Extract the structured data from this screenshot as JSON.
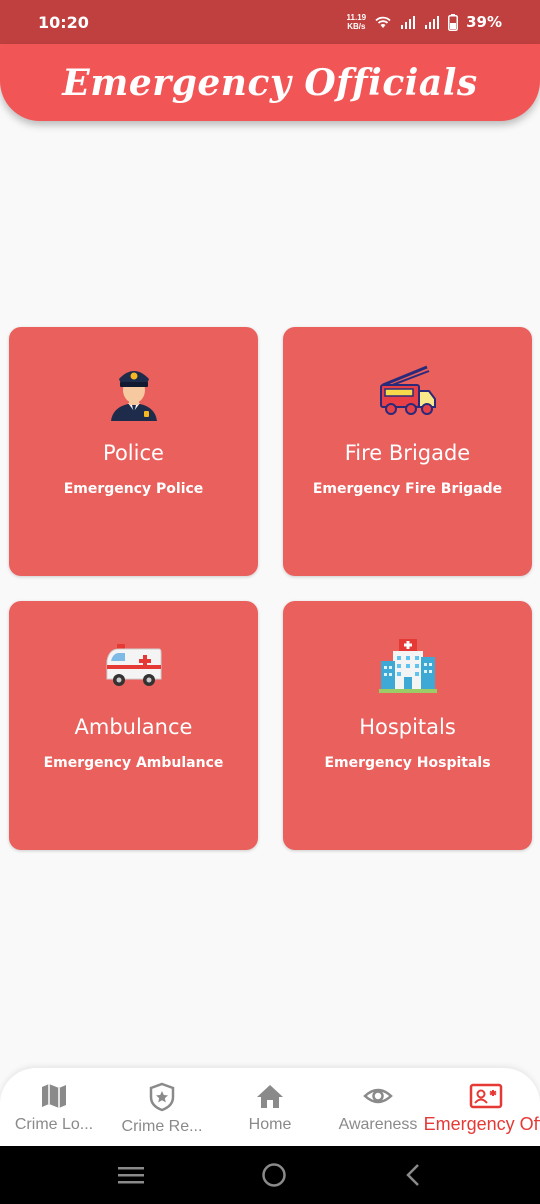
{
  "status_bar": {
    "time": "10:20",
    "net_speed_value": "11.19",
    "net_speed_unit": "KB/s",
    "battery_percent": "39%",
    "icons": [
      "wifi-icon",
      "signal-icon",
      "signal-icon",
      "battery-icon"
    ]
  },
  "header": {
    "title": "Emergency Officials"
  },
  "cards": [
    {
      "icon": "police-officer-icon",
      "title": "Police",
      "subtitle": "Emergency Police"
    },
    {
      "icon": "fire-truck-icon",
      "title": "Fire Brigade",
      "subtitle": "Emergency Fire Brigade"
    },
    {
      "icon": "ambulance-icon",
      "title": "Ambulance",
      "subtitle": "Emergency Ambulance"
    },
    {
      "icon": "hospital-icon",
      "title": "Hospitals",
      "subtitle": "Emergency Hospitals"
    }
  ],
  "bottom_nav": {
    "items": [
      {
        "icon": "map-icon",
        "label": "Crime Lo..."
      },
      {
        "icon": "badge-star-icon",
        "label": "Crime Re..."
      },
      {
        "icon": "home-icon",
        "label": "Home"
      },
      {
        "icon": "eye-icon",
        "label": "Awareness"
      },
      {
        "icon": "contact-card-icon",
        "label": "Emergency Off.",
        "active": true
      }
    ]
  },
  "system_nav": {
    "icons": [
      "recents-icon",
      "home-circle-icon",
      "back-icon"
    ]
  },
  "colors": {
    "status_bar": "#c0403f",
    "header": "#f25555",
    "card": "#e9605d",
    "active_nav": "#e53935",
    "inactive_nav": "#8a8a8a"
  }
}
